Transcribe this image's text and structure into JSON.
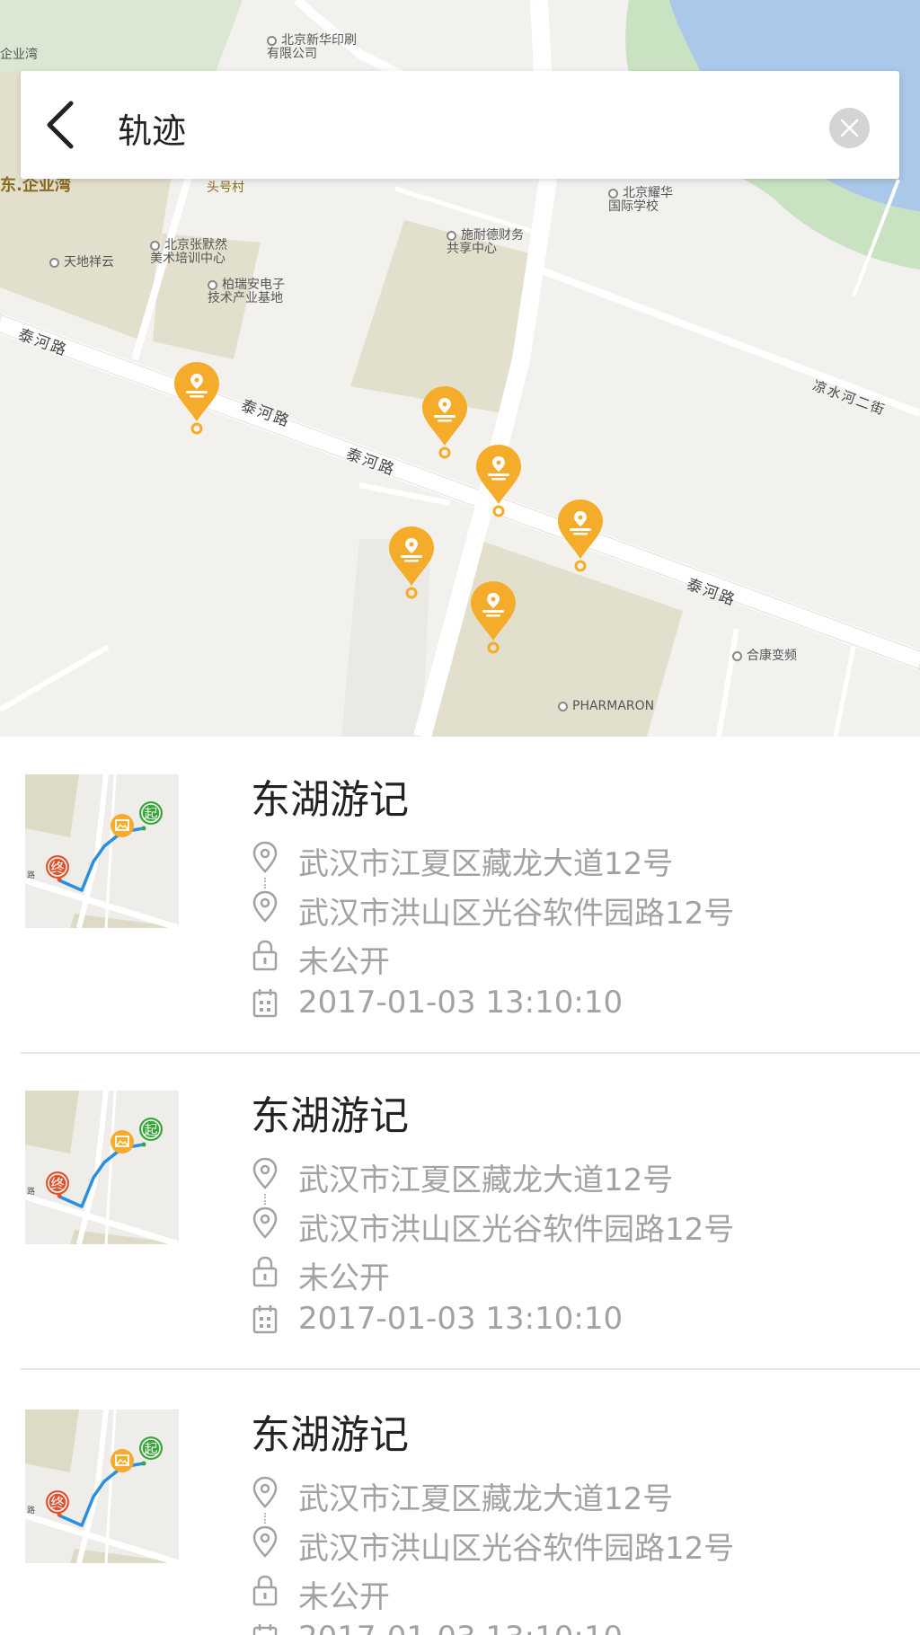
{
  "header": {
    "title": "轨迹",
    "back_icon": "chevron-left-icon",
    "close_icon": "close-icon"
  },
  "map": {
    "poi_labels": [
      "北京新华印刷\n有限公司",
      "北京耀华\n国际学校",
      "施耐德财务\n共享中心",
      "北京张默然\n美术培训中心",
      "天地祥云",
      "柏瑞安电子\n技术产业基地",
      "合康变频",
      "PHARMARON"
    ],
    "area_labels": [
      "企业湾",
      "头号村",
      "东.企业湾"
    ],
    "road_labels": [
      "泰河路",
      "泰河路",
      "泰河路",
      "泰河路",
      "凉水河二街"
    ],
    "marker_color": "#f5ac2a"
  },
  "colors": {
    "accent": "#f5ac2a",
    "start_green": "#3aa53a",
    "end_red": "#e0522e",
    "route_blue": "#2b8fe0",
    "text_gray": "#a2a2a2"
  },
  "trips": [
    {
      "title": "东湖游记",
      "start_address": "武汉市江夏区藏龙大道12号",
      "end_address": "武汉市洪山区光谷软件园路12号",
      "privacy": "未公开",
      "datetime": "2017-01-03  13:10:10",
      "thumb": {
        "start_badge": "起",
        "end_badge": "终",
        "road_text": "路"
      }
    },
    {
      "title": "东湖游记",
      "start_address": "武汉市江夏区藏龙大道12号",
      "end_address": "武汉市洪山区光谷软件园路12号",
      "privacy": "未公开",
      "datetime": "2017-01-03  13:10:10",
      "thumb": {
        "start_badge": "起",
        "end_badge": "终",
        "road_text": "路"
      }
    },
    {
      "title": "东湖游记",
      "start_address": "武汉市江夏区藏龙大道12号",
      "end_address": "武汉市洪山区光谷软件园路12号",
      "privacy": "未公开",
      "datetime": "2017-01-03  13:10:10",
      "thumb": {
        "start_badge": "起",
        "end_badge": "终",
        "road_text": "路"
      }
    }
  ]
}
